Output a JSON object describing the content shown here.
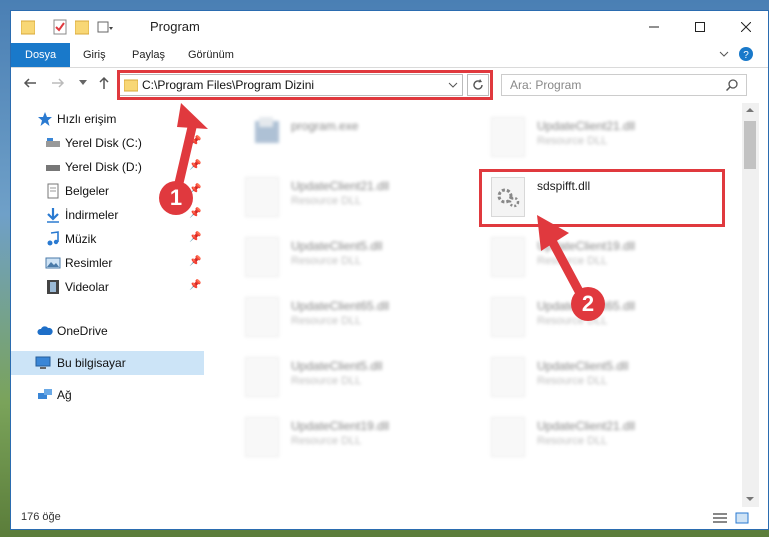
{
  "window": {
    "title": "Program"
  },
  "ribbon": {
    "tabs": [
      {
        "label": "Dosya"
      },
      {
        "label": "Giriş"
      },
      {
        "label": "Paylaş"
      },
      {
        "label": "Görünüm"
      }
    ]
  },
  "nav": {
    "address": "C:\\Program Files\\Program Dizini",
    "search_placeholder": "Ara: Program"
  },
  "sidebar": {
    "items": [
      {
        "label": "Hızlı erişim"
      },
      {
        "label": "Yerel Disk (C:)"
      },
      {
        "label": "Yerel Disk (D:)"
      },
      {
        "label": "Belgeler"
      },
      {
        "label": "İndirmeler"
      },
      {
        "label": "Müzik"
      },
      {
        "label": "Resimler"
      },
      {
        "label": "Videolar"
      },
      {
        "label": "OneDrive"
      },
      {
        "label": "Bu bilgisayar"
      },
      {
        "label": "Ağ"
      }
    ]
  },
  "files": [
    {
      "name": "program.exe",
      "type": ""
    },
    {
      "name": "UpdateClient21.dll",
      "type": "Resource DLL"
    },
    {
      "name": "UpdateClient21.dll",
      "type": "Resource DLL"
    },
    {
      "name": "sdspifft.dll",
      "type": ""
    },
    {
      "name": "UpdateClient5.dll",
      "type": "Resource DLL"
    },
    {
      "name": "UpdateClient19.dll",
      "type": "Resource DLL"
    },
    {
      "name": "UpdateClient65.dll",
      "type": "Resource DLL"
    },
    {
      "name": "UpdateClient65.dll",
      "type": "Resource DLL"
    },
    {
      "name": "UpdateClient5.dll",
      "type": "Resource DLL"
    },
    {
      "name": "UpdateClient5.dll",
      "type": "Resource DLL"
    },
    {
      "name": "UpdateClient19.dll",
      "type": "Resource DLL"
    },
    {
      "name": "UpdateClient21.dll",
      "type": "Resource DLL"
    }
  ],
  "status": {
    "count": "176 öğe"
  },
  "callouts": {
    "one": "1",
    "two": "2"
  },
  "colors": {
    "accent": "#1979ca",
    "highlight": "#e0393e",
    "selected": "#cce4f7"
  }
}
